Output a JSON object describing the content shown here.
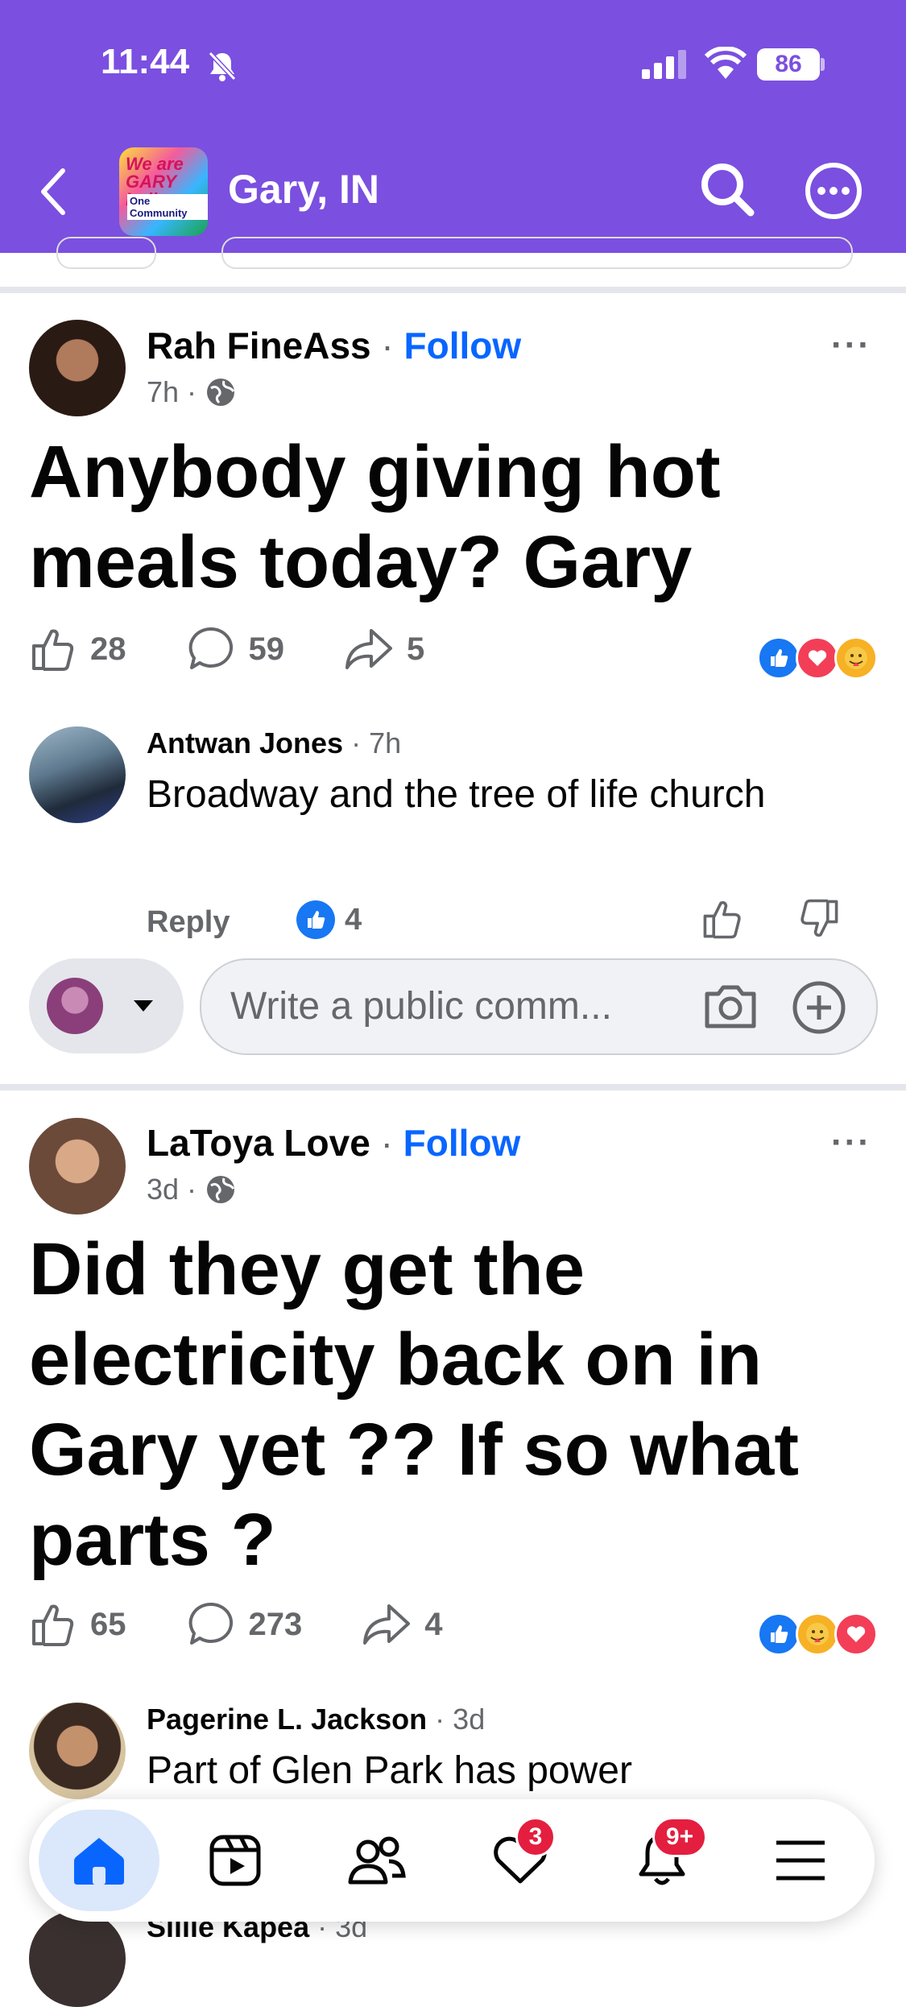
{
  "status": {
    "time": "11:44",
    "battery": "86"
  },
  "header": {
    "title": "Gary, IN",
    "group_image_text": "We are GARY Indiana",
    "group_image_sub": "One Community"
  },
  "posts": [
    {
      "author": "Rah FineAss",
      "follow": "Follow",
      "time": "7h",
      "text": "Anybody giving hot meals today? Gary",
      "likes": "28",
      "comments": "59",
      "shares": "5",
      "top_comment": {
        "author": "Antwan Jones",
        "time": "7h",
        "text": "Broadway and the tree of life church",
        "reply": "Reply",
        "likes": "4"
      },
      "composer_placeholder": "Write a public comm..."
    },
    {
      "author": "LaToya Love",
      "follow": "Follow",
      "time": "3d",
      "text": "Did they get the electricity back on in Gary yet ?? If so what parts ?",
      "likes": "65",
      "comments": "273",
      "shares": "4",
      "top_comment": {
        "author": "Pagerine L. Jackson",
        "time": "3d",
        "text": "Part of Glen Park has power"
      },
      "next_comment": {
        "author": "Sillie Kapea",
        "time": "3d"
      }
    }
  ],
  "tabbar": {
    "notifications_badge": "9+",
    "hearts_badge": "3"
  },
  "colors": {
    "brand": "#7b4fe0",
    "link": "#0866ff",
    "like": "#1877f2",
    "love": "#f33e58",
    "badge": "#e41e3f"
  }
}
